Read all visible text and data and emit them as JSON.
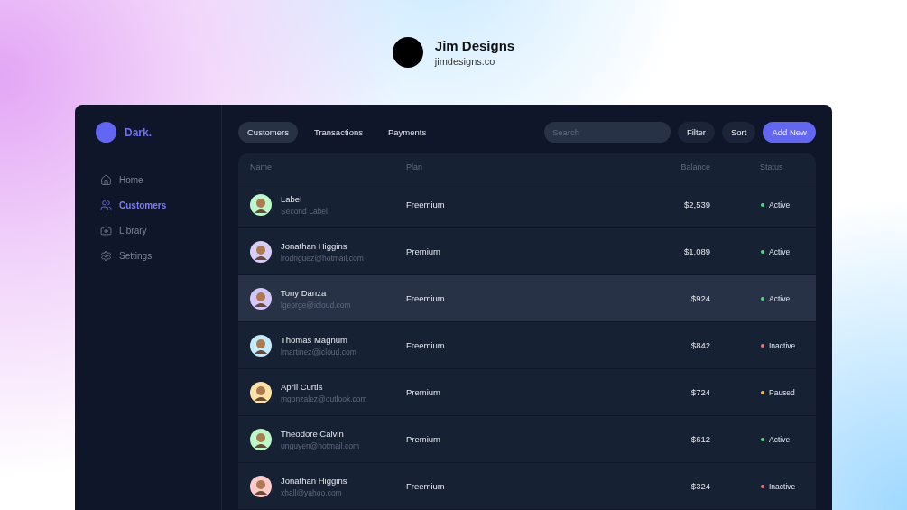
{
  "profile": {
    "name": "Jim Designs",
    "site": "jimdesigns.co"
  },
  "brand": {
    "name": "Dark."
  },
  "sidebar": {
    "items": [
      {
        "label": "Home",
        "selected": false
      },
      {
        "label": "Customers",
        "selected": true
      },
      {
        "label": "Library",
        "selected": false
      },
      {
        "label": "Settings",
        "selected": false
      }
    ]
  },
  "tabs": [
    {
      "label": "Customers",
      "selected": true
    },
    {
      "label": "Transactions",
      "selected": false
    },
    {
      "label": "Payments",
      "selected": false
    }
  ],
  "search": {
    "placeholder": "Search"
  },
  "buttons": [
    {
      "label": "Filter",
      "kind": "plain"
    },
    {
      "label": "Sort",
      "kind": "plain"
    },
    {
      "label": "Add New",
      "kind": "primary"
    }
  ],
  "table": {
    "columns": [
      "Name",
      "Plan",
      "Balance",
      "Status"
    ],
    "rows": [
      {
        "name": "Label",
        "email": "Second Label",
        "plan": "Freemium",
        "balance": "$2,539",
        "status": {
          "label": "Active",
          "color": "#4ade80"
        },
        "avatar": {
          "color": "#bbf7c8"
        },
        "hovered": false
      },
      {
        "name": "Jonathan Higgins",
        "email": "lrodriguez@hotmail.com",
        "plan": "Premium",
        "balance": "$1,089",
        "status": {
          "label": "Active",
          "color": "#4ade80"
        },
        "avatar": {
          "color": "#d9ccf5"
        },
        "hovered": false
      },
      {
        "name": "Tony Danza",
        "email": "lgeorge@icloud.com",
        "plan": "Freemium",
        "balance": "$924",
        "status": {
          "label": "Active",
          "color": "#4ade80"
        },
        "avatar": {
          "color": "#d4c8fb"
        },
        "hovered": true
      },
      {
        "name": "Thomas Magnum",
        "email": "lmartinez@icloud.com",
        "plan": "Freemium",
        "balance": "$842",
        "status": {
          "label": "Inactive",
          "color": "#f87171"
        },
        "avatar": {
          "color": "#c2ecfb"
        },
        "hovered": false
      },
      {
        "name": "April Curtis",
        "email": "mgonzalez@outlook.com",
        "plan": "Premium",
        "balance": "$724",
        "status": {
          "label": "Paused",
          "color": "#fbbf24"
        },
        "avatar": {
          "color": "#fde2a8"
        },
        "hovered": false
      },
      {
        "name": "Theodore Calvin",
        "email": "unguyen@hotmail.com",
        "plan": "Premium",
        "balance": "$612",
        "status": {
          "label": "Active",
          "color": "#4ade80"
        },
        "avatar": {
          "color": "#bbf7c8"
        },
        "hovered": false
      },
      {
        "name": "Jonathan Higgins",
        "email": "xhall@yahoo.com",
        "plan": "Freemium",
        "balance": "$324",
        "status": {
          "label": "Inactive",
          "color": "#f87171"
        },
        "avatar": {
          "color": "#fecaca"
        },
        "hovered": false
      }
    ]
  }
}
